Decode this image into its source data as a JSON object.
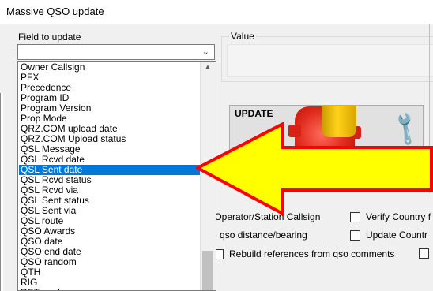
{
  "window": {
    "title": "Massive QSO update"
  },
  "field_to_update": {
    "label": "Field to update",
    "selected_value": "",
    "options": [
      "Owner Callsign",
      "PFX",
      "Precedence",
      "Program ID",
      "Program Version",
      "Prop Mode",
      "QRZ.COM upload date",
      "QRZ.COM Upload status",
      "QSL Message",
      "QSL Rcvd date",
      "QSL Sent date",
      "QSL Rcvd status",
      "QSL Rcvd via",
      "QSL Sent status",
      "QSL Sent via",
      "QSL route",
      "QSO Awards",
      "QSO date",
      "QSO end date",
      "QSO random",
      "QTH",
      "RIG",
      "RST rcvd"
    ],
    "highlighted_option": "QSL Sent date"
  },
  "value": {
    "label": "Value"
  },
  "update_button": {
    "label": "UPDATE"
  },
  "options": {
    "verify_operator": "ry Operator/Station Callsign",
    "verify_country": "Verify Country f",
    "update_distance": "ate qso distance/bearing",
    "update_country": "Update Countr",
    "rebuild_refs": "Rebuild references from qso comments"
  },
  "colors": {
    "selection": "#0078d7",
    "arrow_fill": "#ffff00",
    "arrow_stroke": "#ff0000"
  }
}
